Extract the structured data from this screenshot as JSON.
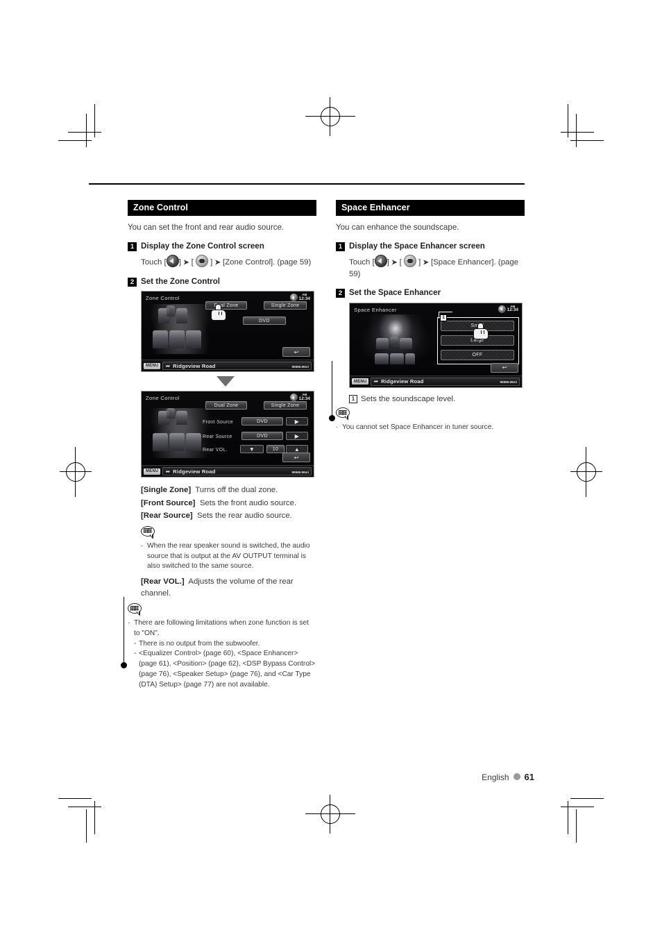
{
  "page": {
    "footer_language": "English",
    "footer_page": "61"
  },
  "left": {
    "section_title": "Zone Control",
    "intro": "You can set the front and rear audio source.",
    "steps": [
      {
        "num": "1",
        "title": "Display the Zone Control screen"
      },
      {
        "num": "2",
        "title": "Set the Zone Control"
      }
    ],
    "touch": {
      "prefix": "Touch [",
      "mid1": "] ",
      "arrow": "➤",
      "mid2": " [ ",
      "mid3": " ] ",
      "suffix": " [Zone Control]. (page 59)"
    },
    "device1": {
      "title": "Zone Control",
      "ampm": "AM",
      "time": "12:34",
      "dual_zone": "Dual Zone",
      "single_zone": "Single Zone",
      "source": "DVD",
      "return_icon": "↩",
      "foot_menu": "MENU",
      "foot_icon": "➦",
      "foot_name": "Ridgeview Road",
      "foot_value": "99999.99",
      "foot_unit": "mi"
    },
    "device2": {
      "title": "Zone Control",
      "ampm": "AM",
      "time": "12:34",
      "dual_zone": "Dual Zone",
      "single_zone": "Single Zone",
      "front_source_label": "Front Source",
      "front_source_value": "DVD",
      "rear_source_label": "Rear Source",
      "rear_source_value": "DVD",
      "rear_vol_label": "Rear VOL.",
      "rear_vol_value": "10",
      "next_icon": "▶",
      "down_icon": "▼",
      "up_icon": "▲",
      "return_icon": "↩",
      "foot_menu": "MENU",
      "foot_icon": "➦",
      "foot_name": "Ridgeview Road",
      "foot_value": "99999.99",
      "foot_unit": "mi"
    },
    "defs": [
      {
        "term": "[Single Zone]",
        "desc": "Turns off the dual zone."
      },
      {
        "term": "[Front Source]",
        "desc": "Sets the front audio source."
      },
      {
        "term": "[Rear Source]",
        "desc": "Sets the rear audio source."
      }
    ],
    "note1": "When the rear speaker sound is switched, the audio source that is output at the AV OUTPUT terminal is also switched to the same source.",
    "def_rear_vol": {
      "term": "[Rear VOL.]",
      "desc": "Adjusts the volume of the rear channel."
    },
    "note2": {
      "lead": "There are following limitations when zone function is set to \"ON\".",
      "sub": [
        "There is no output from the subwoofer.",
        "<Equalizer Control> (page 60), <Space Enhancer> (page 61), <Position> (page 62), <DSP Bypass Control> (page 76), <Speaker Setup> (page 76), and <Car Type (DTA) Setup> (page 77) are not available."
      ]
    }
  },
  "right": {
    "section_title": "Space Enhancer",
    "intro": "You can enhance the soundscape.",
    "steps": [
      {
        "num": "1",
        "title": "Display the Space Enhancer screen"
      },
      {
        "num": "2",
        "title": "Set the Space Enhancer"
      }
    ],
    "touch": {
      "prefix": "Touch [",
      "mid1": "] ",
      "arrow": "➤",
      "mid2": " [ ",
      "mid3": " ] ",
      "suffix": " [Space Enhancer]. (page 59)"
    },
    "device": {
      "title": "Space Enhancer",
      "ampm": "AM",
      "time": "12:34",
      "callout": "1",
      "option_small": "Small",
      "option_large": "Large",
      "option_off": "OFF",
      "return_icon": "↩",
      "foot_menu": "MENU",
      "foot_icon": "➦",
      "foot_name": "Ridgeview Road",
      "foot_value": "99999.99",
      "foot_unit": "mi"
    },
    "callout_desc": {
      "num": "1",
      "text": "Sets the soundscape level."
    },
    "note": "You cannot set Space Enhancer in tuner source.",
    "bullet_char": "·",
    "dash_char": "-"
  },
  "symbols": {
    "arrow_sep": "➤",
    "bullet": "·",
    "dash": "-"
  },
  "colors": {
    "header_bg": "#000000",
    "header_text": "#ffffff",
    "body_text": "#3a3a3c",
    "strong_text": "#231f20",
    "footer_dot": "#9a9a9a"
  }
}
